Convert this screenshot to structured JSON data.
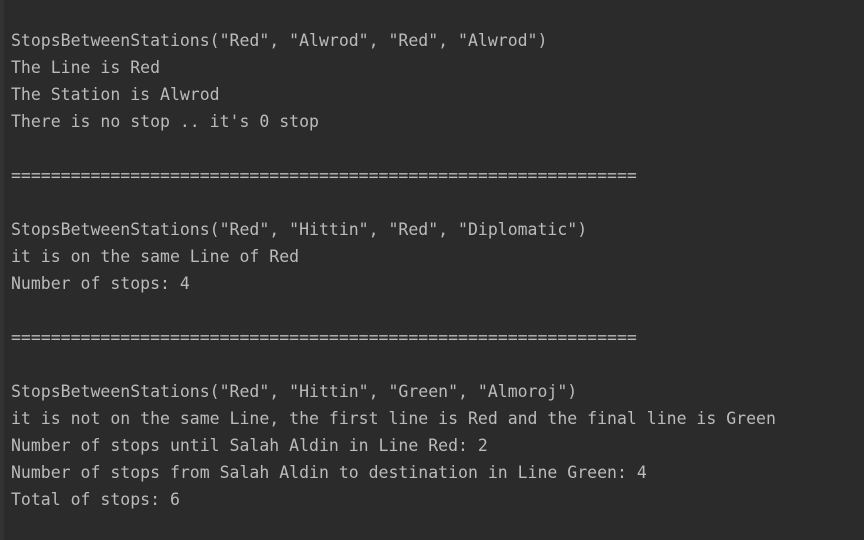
{
  "console": {
    "lines": [
      "StopsBetweenStations(\"Red\", \"Alwrod\", \"Red\", \"Alwrod\")",
      "The Line is Red",
      "The Station is Alwrod",
      "There is no stop .. it's 0 stop",
      "",
      "===============================================================",
      "",
      "StopsBetweenStations(\"Red\", \"Hittin\", \"Red\", \"Diplomatic\")",
      "it is on the same Line of Red",
      "Number of stops: 4",
      "",
      "===============================================================",
      "",
      "StopsBetweenStations(\"Red\", \"Hittin\", \"Green\", \"Almoroj\")",
      "it is not on the same Line, the first line is Red and the final line is Green",
      "Number of stops until Salah Aldin in Line Red: 2",
      "Number of stops from Salah Aldin to destination in Line Green: 4",
      "Total of stops: 6"
    ]
  }
}
